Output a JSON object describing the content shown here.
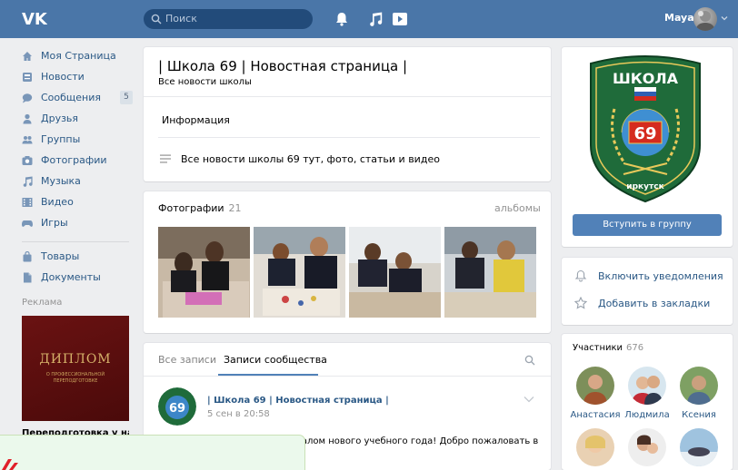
{
  "header": {
    "search_placeholder": "Поиск",
    "user_name": "Maya",
    "brand_color": "#4a76a8"
  },
  "sidebar": {
    "items": [
      {
        "label": "Моя Страница",
        "icon": "home-icon"
      },
      {
        "label": "Новости",
        "icon": "news-icon"
      },
      {
        "label": "Сообщения",
        "icon": "messages-icon",
        "count": "5"
      },
      {
        "label": "Друзья",
        "icon": "friends-icon"
      },
      {
        "label": "Группы",
        "icon": "groups-icon"
      },
      {
        "label": "Фотографии",
        "icon": "camera-icon"
      },
      {
        "label": "Музыка",
        "icon": "music-icon"
      },
      {
        "label": "Видео",
        "icon": "video-icon"
      },
      {
        "label": "Игры",
        "icon": "games-icon"
      },
      {
        "label": "Товары",
        "icon": "bag-icon"
      },
      {
        "label": "Документы",
        "icon": "document-icon"
      }
    ],
    "ad_label": "Реклама",
    "ad_title": "ДИПЛОМ",
    "ad_subtitle": "О ПРОФЕССИОНАЛЬНОЙ ПЕРЕПОДГОТОВКЕ",
    "ad_caption": "Переподготовка у нас"
  },
  "group": {
    "title": "| Школа 69 | Новостная страница |",
    "subtitle": "Все новости школы",
    "info_tab": "Информация",
    "description": "Все новости школы 69 тут, фото, статьи и видео"
  },
  "photos": {
    "title": "Фотографии",
    "count": "21",
    "albums_link": "альбомы"
  },
  "posts": {
    "tab_all": "Все записи",
    "tab_community": "Записи сообщества",
    "author": "| Школа 69 | Новостная страница |",
    "date": "5 сен в 20:58",
    "text": "чалом нового учебного года! Добро пожаловать в"
  },
  "right": {
    "emblem_top": "ШКОЛА",
    "emblem_number": "69",
    "emblem_city": "иркутск",
    "join_button": "Вступить в группу",
    "notify": "Включить уведомления",
    "bookmark": "Добавить в закладки",
    "members_title": "Участники",
    "members_count": "676",
    "members": [
      "Анастасия",
      "Людмила",
      "Ксения"
    ]
  },
  "overlay": {
    "accent_color": "#e0202a"
  }
}
